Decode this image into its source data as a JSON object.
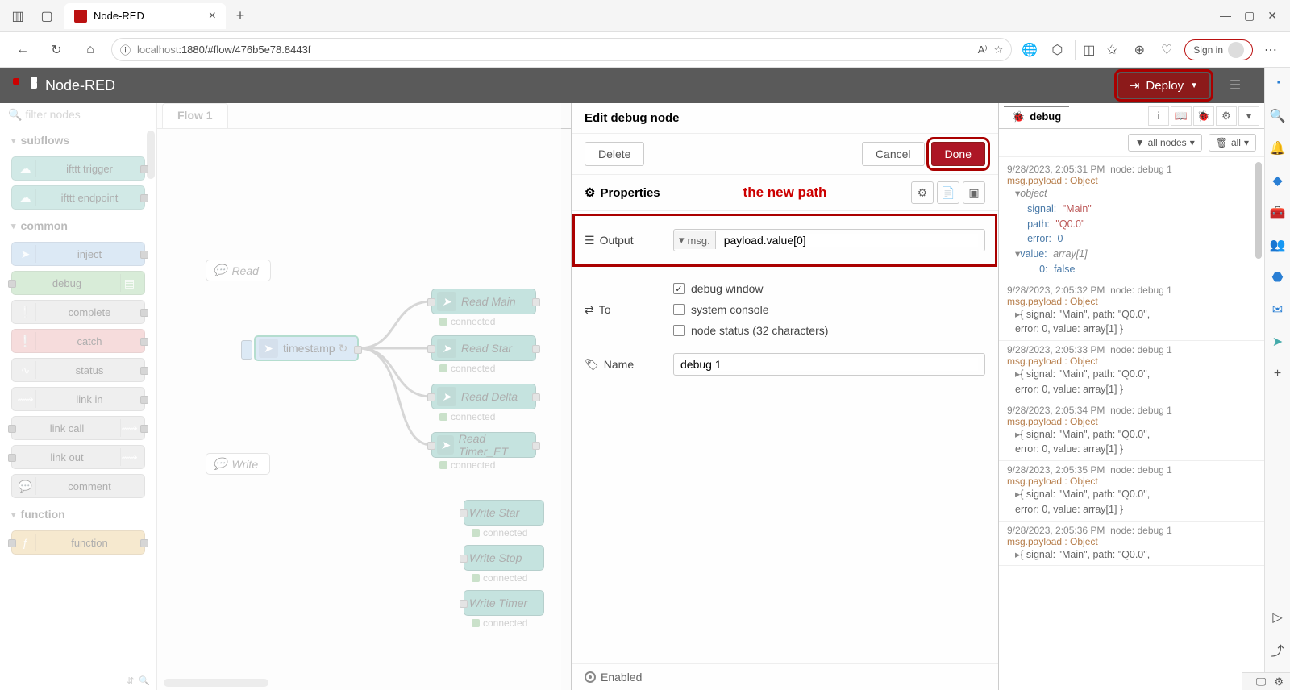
{
  "browser": {
    "tab_title": "Node-RED",
    "url_host": "localhost",
    "url_port_path": ":1880/#flow/476b5e78.8443f",
    "signin": "Sign in"
  },
  "nr": {
    "title": "Node-RED",
    "deploy": "Deploy"
  },
  "palette": {
    "search_placeholder": "filter nodes",
    "cat_subflows": "subflows",
    "cat_common": "common",
    "cat_function": "function",
    "n_ifttt_trigger": "ifttt trigger",
    "n_ifttt_endpoint": "ifttt endpoint",
    "n_inject": "inject",
    "n_debug": "debug",
    "n_complete": "complete",
    "n_catch": "catch",
    "n_status": "status",
    "n_linkin": "link in",
    "n_linkcall": "link call",
    "n_linkout": "link out",
    "n_comment": "comment",
    "n_function": "function"
  },
  "workspace": {
    "tab": "Flow 1",
    "comment_read": "Read",
    "comment_write": "Write",
    "inject": "timestamp",
    "read_main": "Read Main",
    "read_star": "Read Star",
    "read_delta": "Read Delta",
    "read_timer": "Read Timer_ET",
    "write_star": "Write Star",
    "write_stop": "Write Stop",
    "write_timer": "Write Timer",
    "connected": "connected"
  },
  "tray": {
    "title": "Edit debug node",
    "delete": "Delete",
    "cancel": "Cancel",
    "done": "Done",
    "properties": "Properties",
    "annotation": "the new path",
    "output_label": "Output",
    "output_prefix": "msg.",
    "output_value": "payload.value[0]",
    "to_label": "To",
    "to_debugwin": "debug window",
    "to_console": "system console",
    "to_status": "node status (32 characters)",
    "name_label": "Name",
    "name_value": "debug 1",
    "enabled": "Enabled"
  },
  "debug": {
    "title": "debug",
    "filter_all": "all nodes",
    "trash_all": "all",
    "common_node": "node: debug 1",
    "common_path": "msg.payload : Object",
    "obj_line1": "{ signal: \"Main\", path: \"Q0.0\",",
    "obj_line2": "error: 0, value: array[1] }",
    "exp_obj": "object",
    "exp_signal_k": "signal:",
    "exp_signal_v": "\"Main\"",
    "exp_path_k": "path:",
    "exp_path_v": "\"Q0.0\"",
    "exp_error_k": "error:",
    "exp_error_v": "0",
    "exp_value_k": "value:",
    "exp_value_v": "array[1]",
    "exp_arr_idx": "0:",
    "exp_arr_val": "false",
    "ts": [
      "9/28/2023, 2:05:31 PM",
      "9/28/2023, 2:05:32 PM",
      "9/28/2023, 2:05:33 PM",
      "9/28/2023, 2:05:34 PM",
      "9/28/2023, 2:05:35 PM",
      "9/28/2023, 2:05:36 PM"
    ]
  }
}
